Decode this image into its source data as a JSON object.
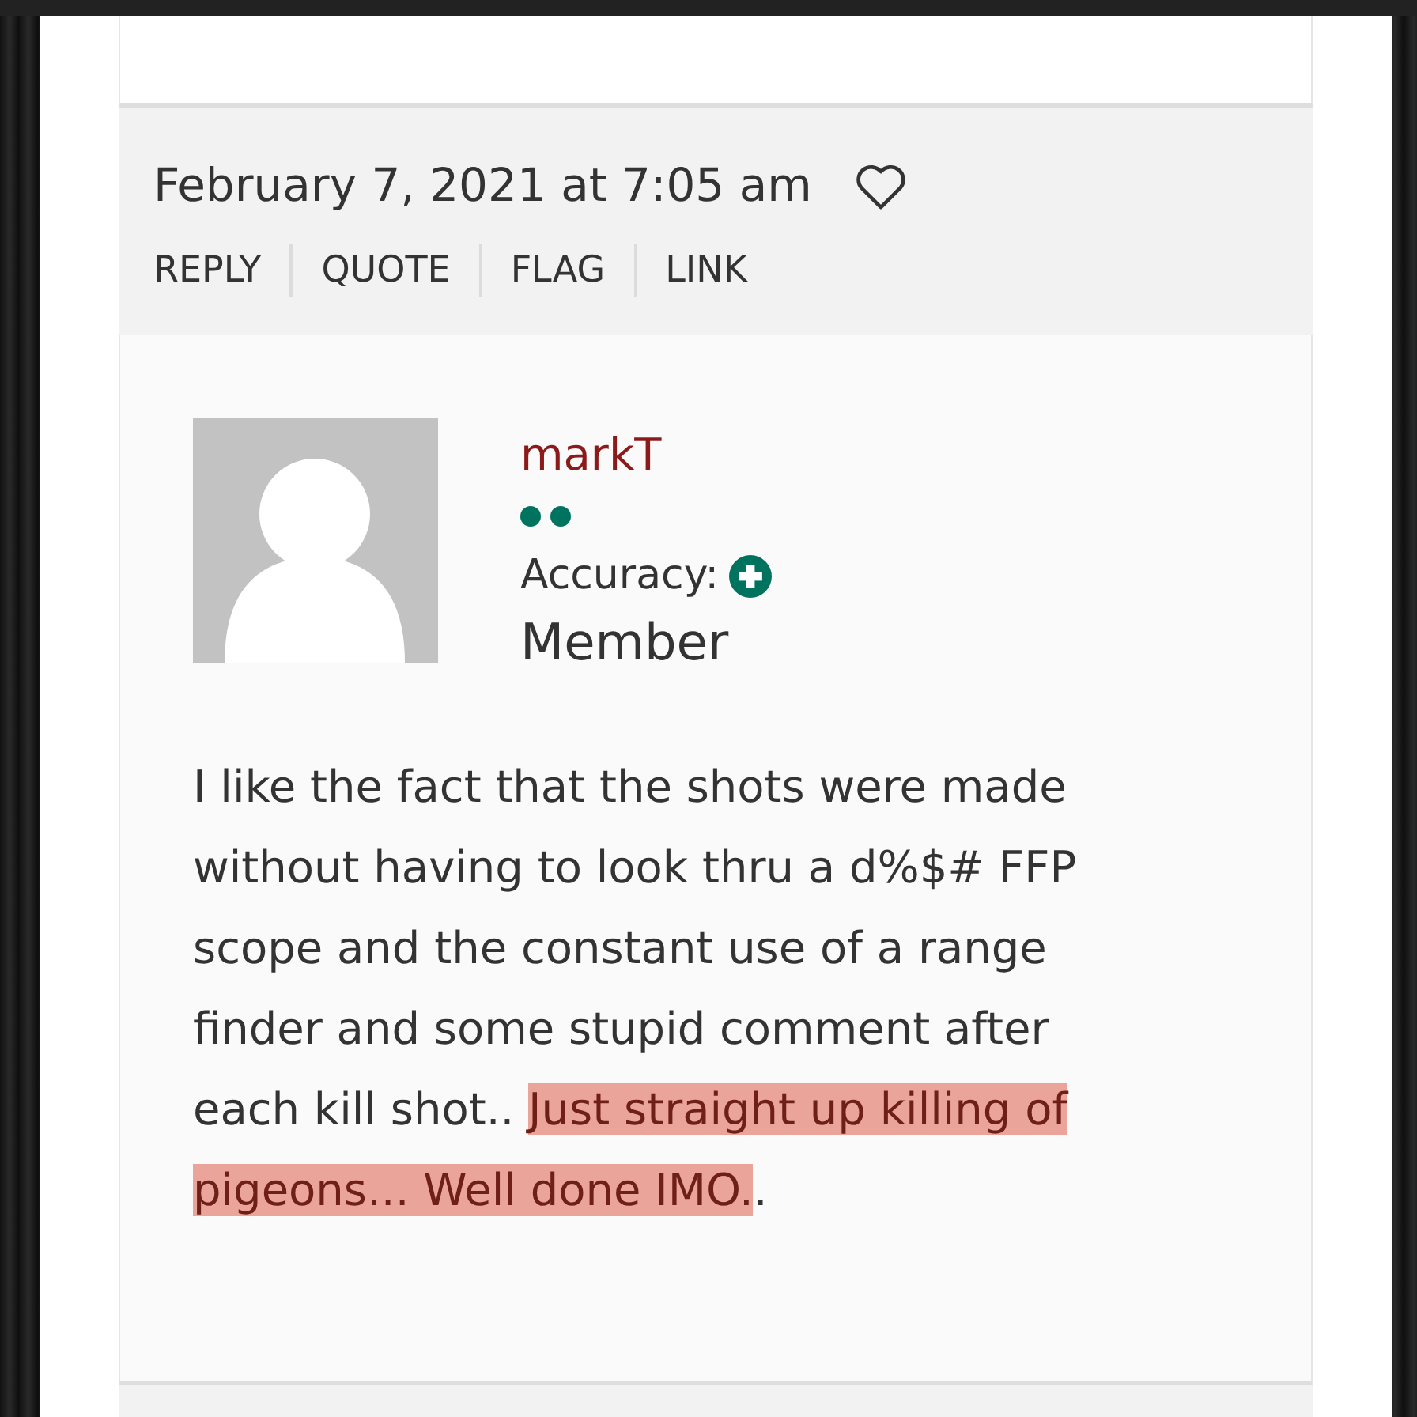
{
  "comment": {
    "date": "February 7, 2021 at 7:05 am",
    "liked": false,
    "actions": [
      "REPLY",
      "QUOTE",
      "FLAG",
      "LINK"
    ],
    "author": {
      "name": "markT",
      "accuracy_label": "Accuracy:",
      "role": "Member"
    },
    "body": [
      {
        "text": "I like the fact that the shots were made without having to look thru a d%$# FFP scope and the constant use of a range finder and some stupid comment after each kill shot.. ",
        "highlighted": false
      },
      {
        "text": "Just straight up killing of pigeons... Well done IMO.",
        "highlighted": true
      },
      {
        "text": ".",
        "highlighted": false
      }
    ]
  }
}
